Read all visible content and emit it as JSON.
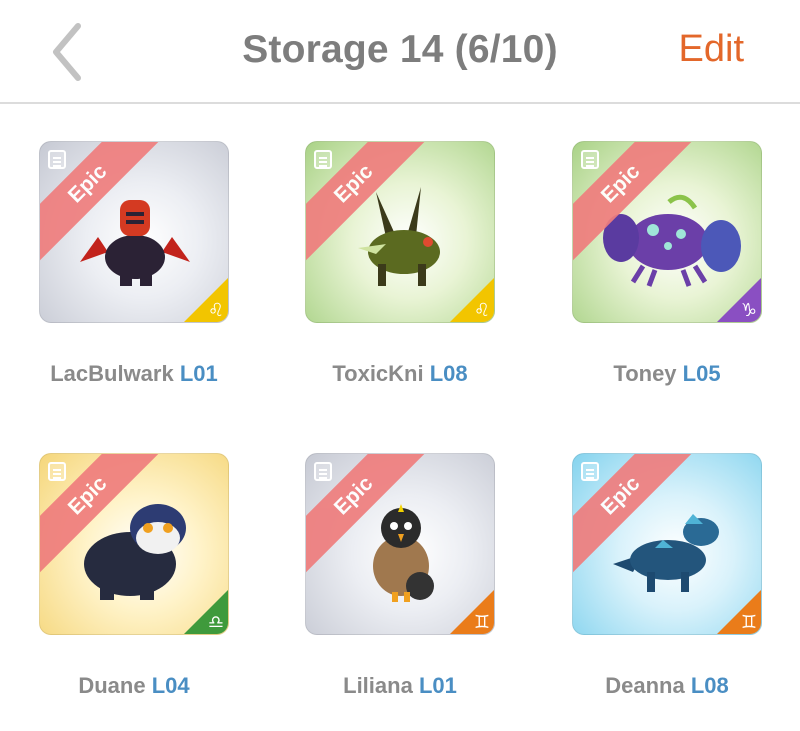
{
  "header": {
    "title": "Storage 14 (6/10)",
    "edit_label": "Edit"
  },
  "cards": [
    {
      "name": "LacBulwark",
      "level": "L01",
      "rarity": "Epic",
      "bg": "gray",
      "zodiac_icon": "leo-icon",
      "zodiac_glyph": "♌",
      "zodiac_color": "#f2c500"
    },
    {
      "name": "ToxicKni",
      "level": "L08",
      "rarity": "Epic",
      "bg": "green",
      "zodiac_icon": "leo-icon",
      "zodiac_glyph": "♌",
      "zodiac_color": "#f2c500"
    },
    {
      "name": "Toney",
      "level": "L05",
      "rarity": "Epic",
      "bg": "green",
      "zodiac_icon": "capricorn-icon",
      "zodiac_glyph": "♑",
      "zodiac_color": "#8a4fc2"
    },
    {
      "name": "Duane",
      "level": "L04",
      "rarity": "Epic",
      "bg": "yellow",
      "zodiac_icon": "libra-icon",
      "zodiac_glyph": "♎",
      "zodiac_color": "#3f9a3c"
    },
    {
      "name": "Liliana",
      "level": "L01",
      "rarity": "Epic",
      "bg": "gray",
      "zodiac_icon": "gemini-icon",
      "zodiac_glyph": "♊",
      "zodiac_color": "#ea7c1a"
    },
    {
      "name": "Deanna",
      "level": "L08",
      "rarity": "Epic",
      "bg": "blue",
      "zodiac_icon": "gemini-icon",
      "zodiac_glyph": "♊",
      "zodiac_color": "#ea7c1a"
    }
  ]
}
